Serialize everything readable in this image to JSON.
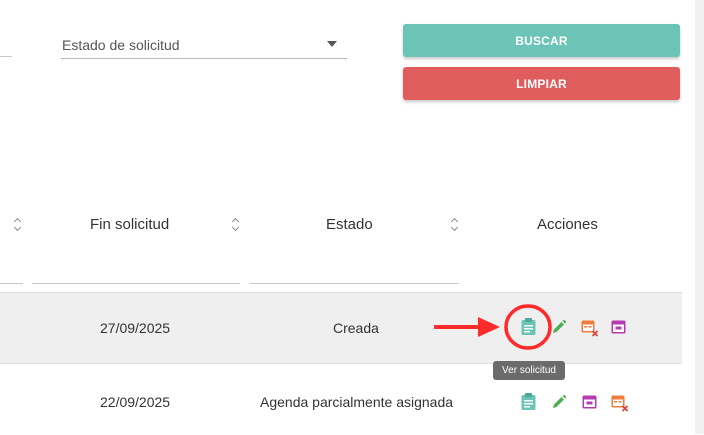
{
  "filters": {
    "estado_label": "Estado de solicitud",
    "buscar_label": "BUSCAR",
    "limpiar_label": "LIMPIAR"
  },
  "table": {
    "headers": [
      "Fin solicitud",
      "Estado",
      "Acciones"
    ],
    "rows": [
      {
        "fin_solicitud": "27/09/2025",
        "estado": "Creada"
      },
      {
        "fin_solicitud": "22/09/2025",
        "estado": "Agenda parcialmente asignada"
      }
    ]
  },
  "tooltip": "Ver solicitud",
  "icons": [
    "clipboard-icon",
    "pencil-icon",
    "calendar-cancel-icon",
    "calendar-icon"
  ],
  "colors": {
    "buscar": "#6bc4b5",
    "limpiar": "#e05d5d",
    "view_icon": "#6bc4b5",
    "edit_icon": "#4caf50",
    "calendar_cancel_icon": "#ef7d3c",
    "calendar_icon": "#b43bb0",
    "annotation_red": "#ff2a2a"
  }
}
